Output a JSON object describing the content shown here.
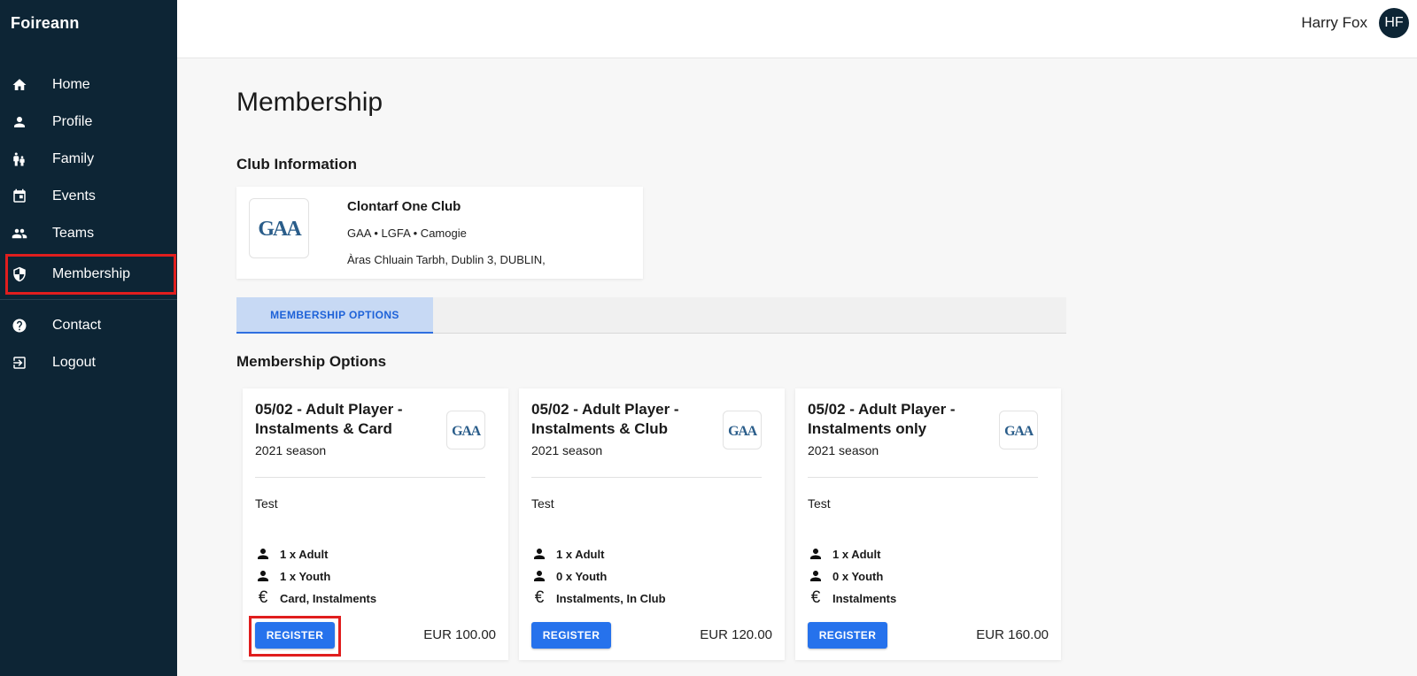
{
  "app": {
    "name": "Foireann"
  },
  "sidebar": {
    "items": [
      {
        "label": "Home",
        "icon": "home-icon"
      },
      {
        "label": "Profile",
        "icon": "person-icon"
      },
      {
        "label": "Family",
        "icon": "family-icon"
      },
      {
        "label": "Events",
        "icon": "calendar-icon"
      },
      {
        "label": "Teams",
        "icon": "group-icon"
      },
      {
        "label": "Membership",
        "icon": "shield-icon",
        "active": true
      },
      {
        "label": "Contact",
        "icon": "help-icon"
      },
      {
        "label": "Logout",
        "icon": "logout-icon"
      }
    ]
  },
  "header": {
    "user_name": "Harry Fox",
    "user_initials": "HF"
  },
  "page": {
    "title": "Membership"
  },
  "club_section": {
    "title": "Club Information"
  },
  "club": {
    "logo_text": "GAA",
    "name": "Clontarf One Club",
    "associations": "GAA • LGFA • Camogie",
    "address": "Àras Chluain Tarbh, Dublin 3, DUBLIN,"
  },
  "tabs": [
    {
      "label": "MEMBERSHIP OPTIONS",
      "active": true
    }
  ],
  "options_section": {
    "title": "Membership Options"
  },
  "options": [
    {
      "title": "05/02 - Adult Player - Instalments & Card",
      "season": "2021 season",
      "description": "Test",
      "adult": "1 x Adult",
      "youth": "1 x Youth",
      "payment": "Card, Instalments",
      "button": "REGISTER",
      "price": "EUR 100.00"
    },
    {
      "title": "05/02 - Adult Player - Instalments & Club",
      "season": "2021 season",
      "description": "Test",
      "adult": "1 x Adult",
      "youth": "0 x Youth",
      "payment": "Instalments, In Club",
      "button": "REGISTER",
      "price": "EUR 120.00"
    },
    {
      "title": "05/02 - Adult Player - Instalments only",
      "season": "2021 season",
      "description": "Test",
      "adult": "1 x Adult",
      "youth": "0 x Youth",
      "payment": "Instalments",
      "button": "REGISTER",
      "price": "EUR 160.00"
    }
  ],
  "colors": {
    "sidebar_bg": "#0d2535",
    "accent": "#2672ec",
    "highlight": "#e01e1e",
    "tab_active_bg": "#c7d9f4",
    "gaa_logo": "#2a5d8a"
  }
}
